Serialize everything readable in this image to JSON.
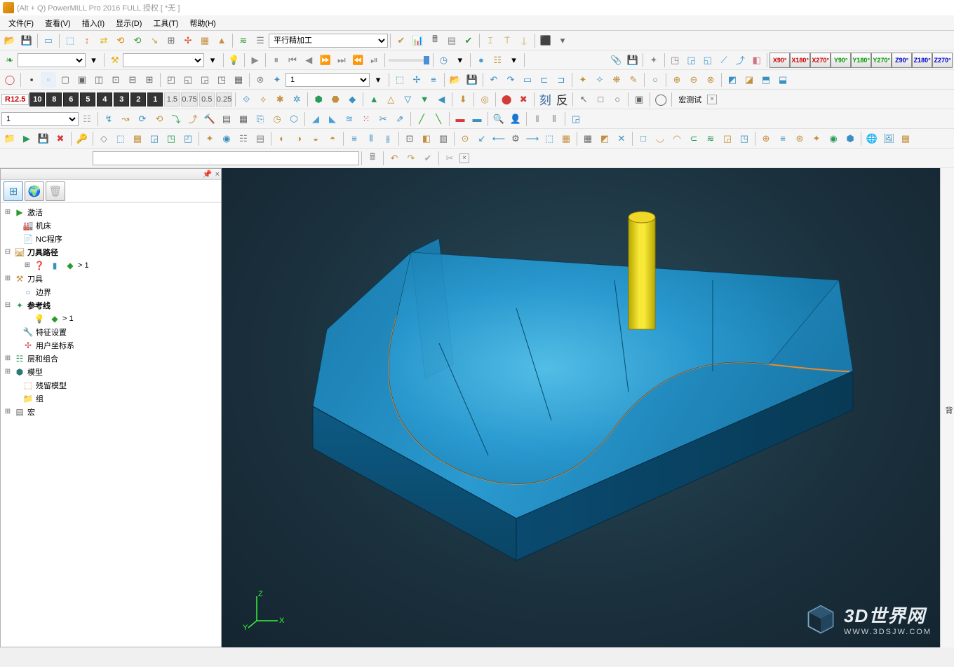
{
  "title": "(Alt + Q) PowerMILL Pro 2016 FULL 授权    [ *无 ]",
  "menu": [
    "文件(F)",
    "查看(V)",
    "插入(I)",
    "显示(D)",
    "工具(T)",
    "帮助(H)"
  ],
  "strategy_combo": "平行精加工",
  "combo_1": "1",
  "r_value": "R12.5",
  "step_chips": [
    "10",
    "8",
    "6",
    "5",
    "4",
    "3",
    "2",
    "1"
  ],
  "step_chips_sm": [
    "1.5",
    "0.75",
    "0.5",
    "0.25"
  ],
  "num_combo_row5": "1",
  "macro_test": "宏测试",
  "row6_combo": "1",
  "rot_chips": [
    "X90°",
    "X180°",
    "X270°",
    "Y90°",
    "Y180°",
    "Y270°",
    "Z90°",
    "Z180°",
    "Z270°"
  ],
  "ke": "刻",
  "fan": "反",
  "tree": {
    "active": "激活",
    "machine": "机床",
    "nc": "NC程序",
    "toolpath": "刀具路径",
    "tp_child": "> 1",
    "tools": "刀具",
    "boundary": "边界",
    "pattern": "参考线",
    "pat_child": "> 1",
    "feature": "特征设置",
    "wcs": "用户坐标系",
    "layers": "层和组合",
    "model": "模型",
    "stock": "残留模型",
    "group": "组",
    "macro": "宏"
  },
  "axis": {
    "x": "X",
    "y": "Y",
    "z": "Z"
  },
  "watermark": {
    "big": "3D世界网",
    "small": "WWW.3DSJW.COM"
  },
  "rside": "背"
}
